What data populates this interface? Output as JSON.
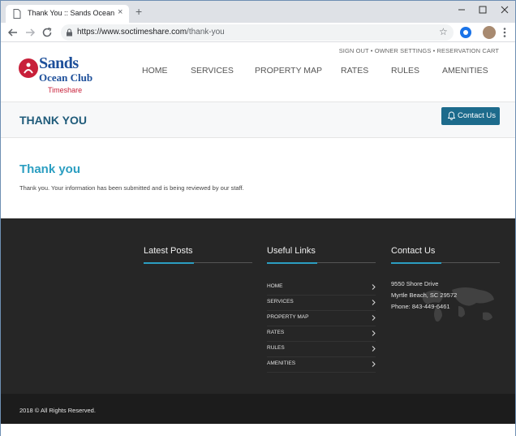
{
  "browser": {
    "tab_title": "Thank You :: Sands Ocean Club T",
    "tab_close": "×",
    "new_tab": "+",
    "url_host": "https://www.soctimeshare.com",
    "url_path": "/thank-you",
    "star": "☆"
  },
  "header": {
    "top_links": "SIGN OUT • OWNER SETTINGS • RESERVATION CART",
    "logo": {
      "line1": "Sands",
      "line2": "Ocean Club",
      "line3": "Timeshare",
      "circle_color": "#c8203a",
      "text_color": "#1d4f9a"
    },
    "nav": [
      "HOME",
      "SERVICES",
      "PROPERTY MAP",
      "RATES",
      "RULES",
      "AMENITIES"
    ]
  },
  "title_bar": {
    "title": "THANK YOU",
    "contact_label": "Contact Us",
    "button_color": "#1d6b8c"
  },
  "main": {
    "heading": "Thank you",
    "message": "Thank you. Your information has been submitted and is being reviewed by our staff."
  },
  "footer": {
    "latest_posts": "Latest Posts",
    "useful_links": {
      "heading": "Useful Links",
      "items": [
        "HOME",
        "SERVICES",
        "PROPERTY MAP",
        "RATES",
        "RULES",
        "AMENITIES"
      ]
    },
    "contact": {
      "heading": "Contact Us",
      "address1": "9550 Shore Drive",
      "address2": "Myrtle Beach, SC 29572",
      "phone": "Phone: 843-449-6461"
    },
    "accent_color": "#2b9ec1",
    "copyright": "2018 © All Rights Reserved."
  }
}
